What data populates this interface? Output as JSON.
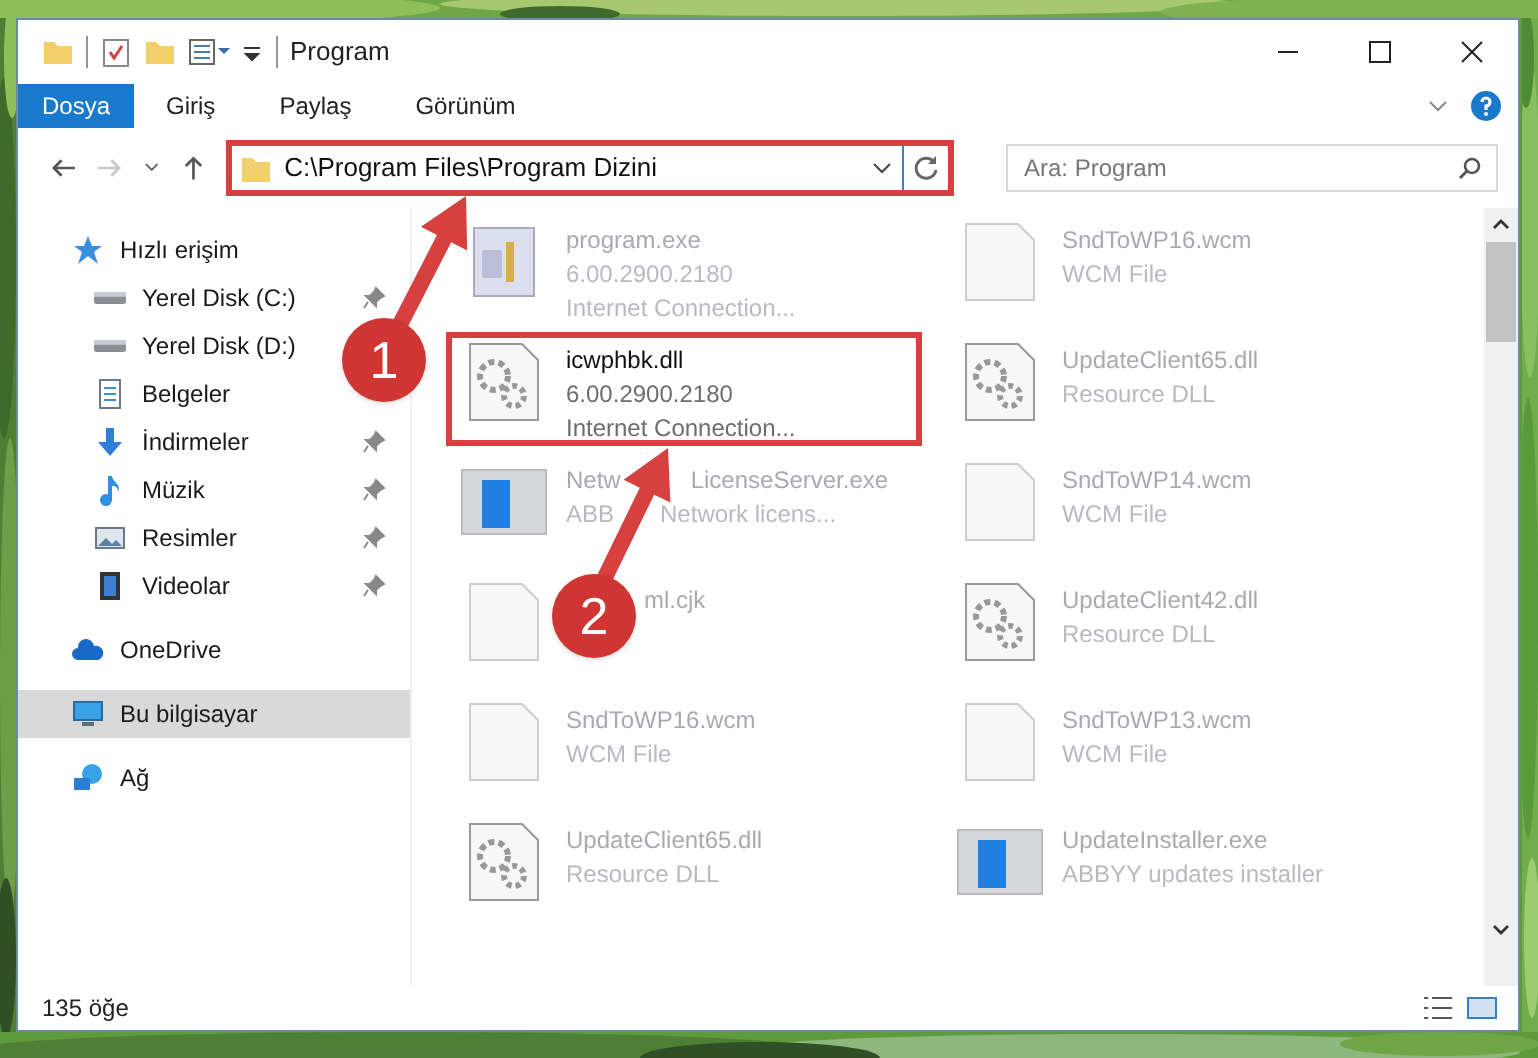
{
  "window": {
    "title": "Program"
  },
  "ribbon_tabs": [
    {
      "label": "Dosya",
      "selected": true
    },
    {
      "label": "Giriş",
      "selected": false
    },
    {
      "label": "Paylaş",
      "selected": false
    },
    {
      "label": "Görünüm",
      "selected": false
    }
  ],
  "address": {
    "path": "C:\\Program Files\\Program Dizini",
    "highlighted": true
  },
  "search": {
    "placeholder": "Ara: Program"
  },
  "sidebar": {
    "items": [
      {
        "label": "Hızlı erişim",
        "kind": "star",
        "selected": false,
        "children": [
          {
            "label": "Yerel Disk (C:)",
            "kind": "drive",
            "pinned": true,
            "selected": false
          },
          {
            "label": "Yerel Disk (D:)",
            "kind": "drive",
            "pinned": false,
            "selected": false
          },
          {
            "label": "Belgeler",
            "kind": "docs",
            "pinned": false,
            "selected": false
          },
          {
            "label": "İndirmeler",
            "kind": "download",
            "pinned": true,
            "selected": false
          },
          {
            "label": "Müzik",
            "kind": "music",
            "pinned": true,
            "selected": false
          },
          {
            "label": "Resimler",
            "kind": "pictures",
            "pinned": true,
            "selected": false
          },
          {
            "label": "Videolar",
            "kind": "video",
            "pinned": true,
            "selected": false
          }
        ]
      },
      {
        "label": "OneDrive",
        "kind": "cloud",
        "selected": false
      },
      {
        "label": "Bu bilgisayar",
        "kind": "pc",
        "selected": true
      },
      {
        "label": "Ağ",
        "kind": "network",
        "selected": false
      }
    ]
  },
  "files": [
    {
      "kind": "exe",
      "name": [
        "program.exe"
      ],
      "lines": [
        [
          "6.00.2900.2180"
        ],
        [
          "Internet Connection..."
        ]
      ],
      "faded": true,
      "highlighted": false,
      "covered": false
    },
    {
      "kind": "file",
      "name": [
        "SndToWP16.wcm"
      ],
      "lines": [
        [
          "WCM File"
        ]
      ],
      "faded": true,
      "highlighted": false,
      "covered": false
    },
    {
      "kind": "dll",
      "name": [
        "icwphbk.dll"
      ],
      "lines": [
        [
          "6.00.2900.2180"
        ],
        [
          "Internet Connection..."
        ]
      ],
      "faded": false,
      "highlighted": true,
      "covered": false
    },
    {
      "kind": "dll",
      "name": [
        "UpdateClient65.dll"
      ],
      "lines": [
        [
          "Resource DLL"
        ]
      ],
      "faded": true,
      "highlighted": false,
      "covered": false
    },
    {
      "kind": "app",
      "name": [
        "Netw",
        "LicenseServer.exe"
      ],
      "lines": [
        [
          "ABB",
          "Network licens..."
        ]
      ],
      "faded": true,
      "highlighted": false,
      "covered": true
    },
    {
      "kind": "file",
      "name": [
        "SndToWP14.wcm"
      ],
      "lines": [
        [
          "WCM File"
        ]
      ],
      "faded": true,
      "highlighted": false,
      "covered": false
    },
    {
      "kind": "file",
      "name": [
        "ml.cjk"
      ],
      "faded": true,
      "highlighted": false,
      "covered": true
    },
    {
      "kind": "dll",
      "name": [
        "UpdateClient42.dll"
      ],
      "lines": [
        [
          "Resource DLL"
        ]
      ],
      "faded": true,
      "highlighted": false,
      "covered": false
    },
    {
      "kind": "file",
      "name": [
        "SndToWP16.wcm"
      ],
      "lines": [
        [
          "WCM File"
        ]
      ],
      "faded": true,
      "highlighted": false,
      "covered": false
    },
    {
      "kind": "file",
      "name": [
        "SndToWP13.wcm"
      ],
      "lines": [
        [
          "WCM File"
        ]
      ],
      "faded": true,
      "highlighted": false,
      "covered": false
    },
    {
      "kind": "dll",
      "name": [
        "UpdateClient65.dll"
      ],
      "lines": [
        [
          "Resource DLL"
        ]
      ],
      "faded": true,
      "highlighted": false,
      "covered": false
    },
    {
      "kind": "app",
      "name": [
        "UpdateInstaller.exe"
      ],
      "lines": [
        [
          "ABBYY updates installer"
        ]
      ],
      "faded": true,
      "highlighted": false,
      "covered": false
    }
  ],
  "status_bar": {
    "count": "135 öğe"
  },
  "annotations": [
    {
      "label": "1"
    },
    {
      "label": "2"
    }
  ]
}
